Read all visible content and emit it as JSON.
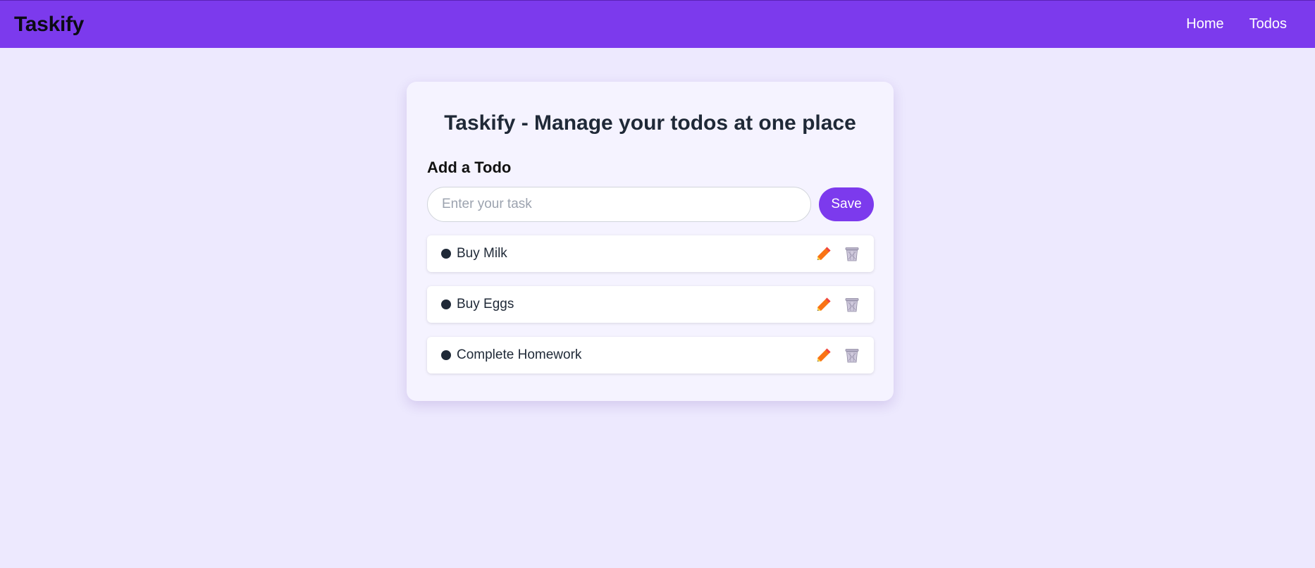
{
  "navbar": {
    "brand": "Taskify",
    "links": [
      {
        "label": "Home"
      },
      {
        "label": "Todos"
      }
    ]
  },
  "main": {
    "title": "Taskify - Manage your todos at one place",
    "add_heading": "Add a Todo",
    "input": {
      "placeholder": "Enter your task",
      "value": ""
    },
    "save_label": "Save",
    "todos": [
      {
        "text": "Buy Milk",
        "edit_icon": "pencil-icon",
        "delete_icon": "trash-icon"
      },
      {
        "text": "Buy Eggs",
        "edit_icon": "pencil-icon",
        "delete_icon": "trash-icon"
      },
      {
        "text": "Complete Homework",
        "edit_icon": "pencil-icon",
        "delete_icon": "trash-icon"
      }
    ]
  },
  "colors": {
    "accent": "#7c3aed",
    "background": "#ede9fe",
    "card": "#f5f3ff",
    "pencil": "#f97316",
    "trash": "#a5a0b8"
  }
}
